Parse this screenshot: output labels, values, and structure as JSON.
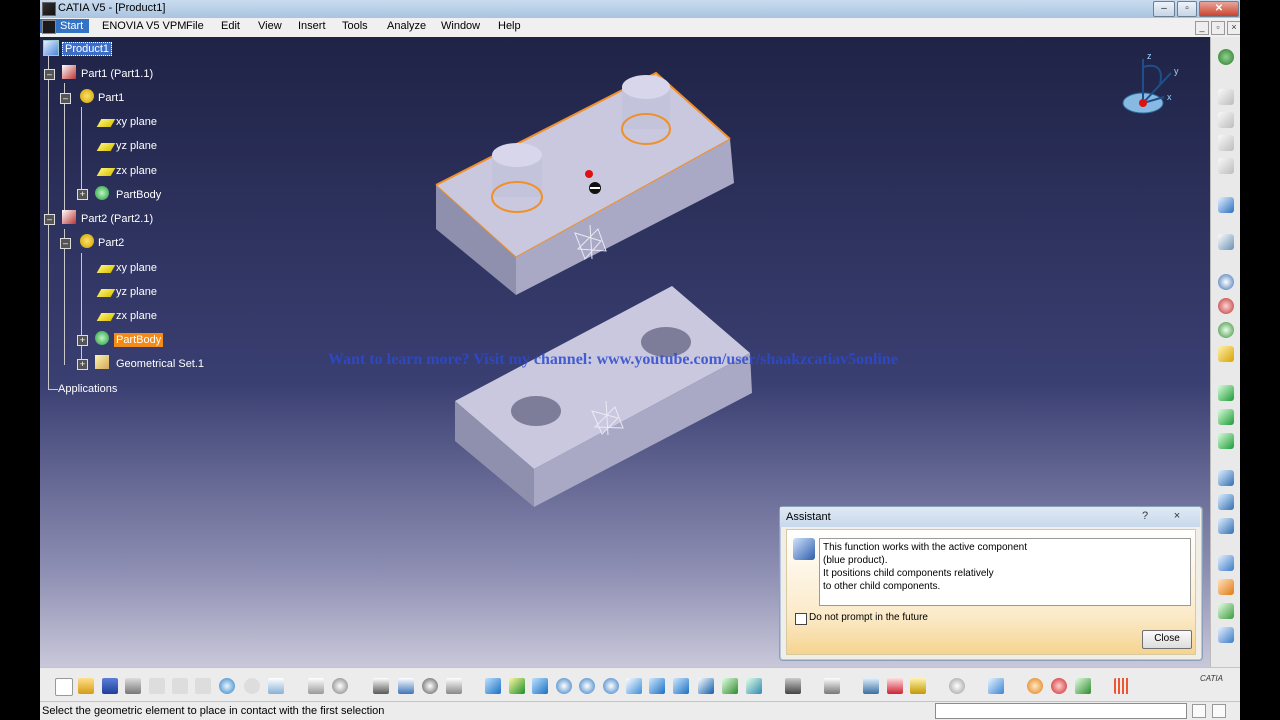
{
  "window": {
    "title": "CATIA V5 - [Product1]"
  },
  "menu": {
    "start": "Start",
    "items": [
      "ENOVIA V5 VPM",
      "File",
      "Edit",
      "View",
      "Insert",
      "Tools",
      "Analyze",
      "Window",
      "Help"
    ]
  },
  "tree": {
    "root": "Product1",
    "part1_instance": "Part1 (Part1.1)",
    "part1": "Part1",
    "part1_xy": "xy plane",
    "part1_yz": "yz plane",
    "part1_zx": "zx plane",
    "part1_body": "PartBody",
    "part2_instance": "Part2 (Part2.1)",
    "part2": "Part2",
    "part2_xy": "xy plane",
    "part2_yz": "yz plane",
    "part2_zx": "zx plane",
    "part2_body": "PartBody",
    "part2_geoset": "Geometrical Set.1",
    "applications": "Applications"
  },
  "compass": {
    "x": "x",
    "y": "y",
    "z": "z"
  },
  "overlay": {
    "watermark": "Want to learn more? Visit my channel: www.youtube.com/user/shaakzcatiav5online"
  },
  "assistant": {
    "title": "Assistant",
    "help": "?",
    "close_x": "×",
    "message": [
      "This function works with the active component",
      "(blue product).",
      "It positions child components relatively",
      "to other child components."
    ],
    "checkbox_label": "Do not prompt in the future",
    "close_button": "Close"
  },
  "status": {
    "text": "Select the geometric element to place in contact with the first selection"
  },
  "brand": {
    "logo": "CATIA"
  },
  "colors": {
    "selection": "#3c6ec8",
    "highlight": "#f28b1a",
    "edge_highlight": "#f0902a"
  }
}
